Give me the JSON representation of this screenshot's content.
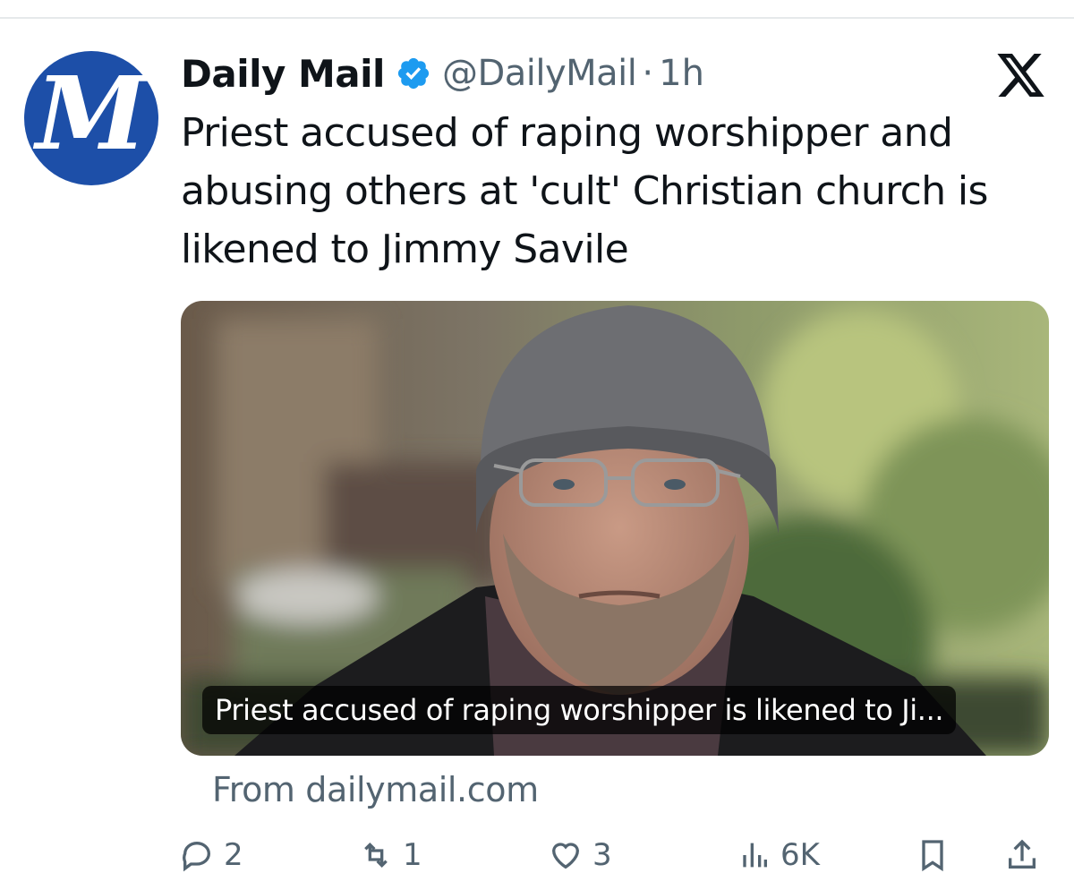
{
  "account": {
    "name": "Daily Mail",
    "handle": "@DailyMail",
    "separator": "·",
    "time": "1h",
    "avatar_letter": "M"
  },
  "post": {
    "text": "Priest accused of raping worshipper and abusing others at 'cult' Christian church is likened to Jimmy Savile"
  },
  "link_card": {
    "caption": "Priest accused of raping worshipper is likened to Ji...",
    "source": "From dailymail.com"
  },
  "actions": {
    "replies": "2",
    "reposts": "1",
    "likes": "3",
    "views": "6K"
  },
  "colors": {
    "brand_blue": "#1d4fa8",
    "verified": "#1d9bf0",
    "secondary_text": "#536471"
  },
  "icons": [
    "verified-badge-icon",
    "x-logo-icon",
    "reply-icon",
    "repost-icon",
    "like-icon",
    "views-icon",
    "bookmark-icon",
    "share-icon"
  ]
}
